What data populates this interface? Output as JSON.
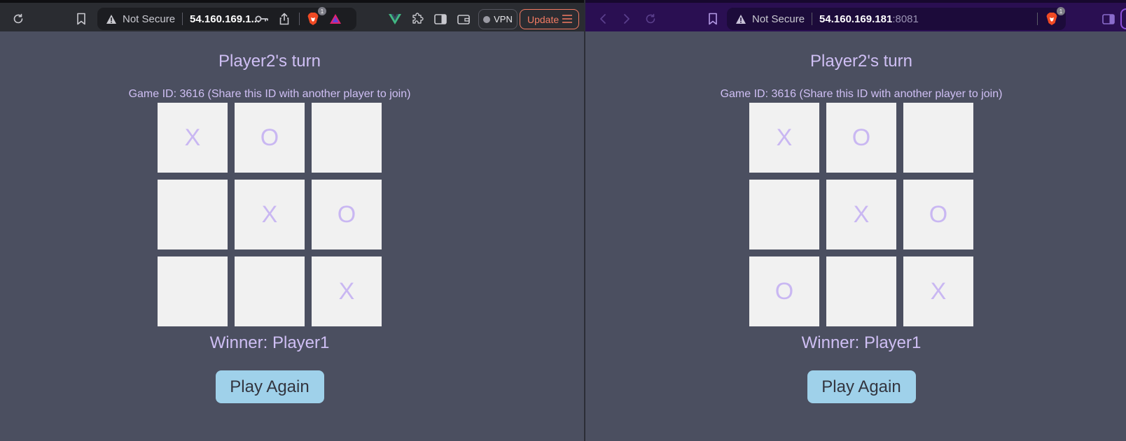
{
  "colors": {
    "page_bg": "#4b4f60",
    "accent_text": "#cfbff4",
    "cell_bg": "#f1f1f1",
    "button_bg": "#9fd1ea",
    "update_accent": "#f37b63",
    "private_window_bar": "#2a0f52"
  },
  "windows": [
    {
      "url": {
        "status": "Not Secure",
        "host": "54.160.169.1...",
        "port": ""
      },
      "brave_badge": "1",
      "vpn_label": "VPN",
      "update_label": "Update",
      "game": {
        "turn_text": "Player2's turn",
        "game_id_text": "Game ID: 3616 (Share this ID with another player to join)",
        "cells": [
          "X",
          "O",
          "",
          "",
          "X",
          "O",
          "",
          "",
          "X"
        ],
        "winner_text": "Winner: Player1",
        "play_again_label": "Play Again"
      }
    },
    {
      "url": {
        "status": "Not Secure",
        "host": "54.160.169.181",
        "port": ":8081"
      },
      "brave_badge": "1",
      "game": {
        "turn_text": "Player2's turn",
        "game_id_text": "Game ID: 3616 (Share this ID with another player to join)",
        "cells": [
          "X",
          "O",
          "",
          "",
          "X",
          "O",
          "O",
          "",
          "X"
        ],
        "winner_text": "Winner: Player1",
        "play_again_label": "Play Again"
      }
    }
  ]
}
